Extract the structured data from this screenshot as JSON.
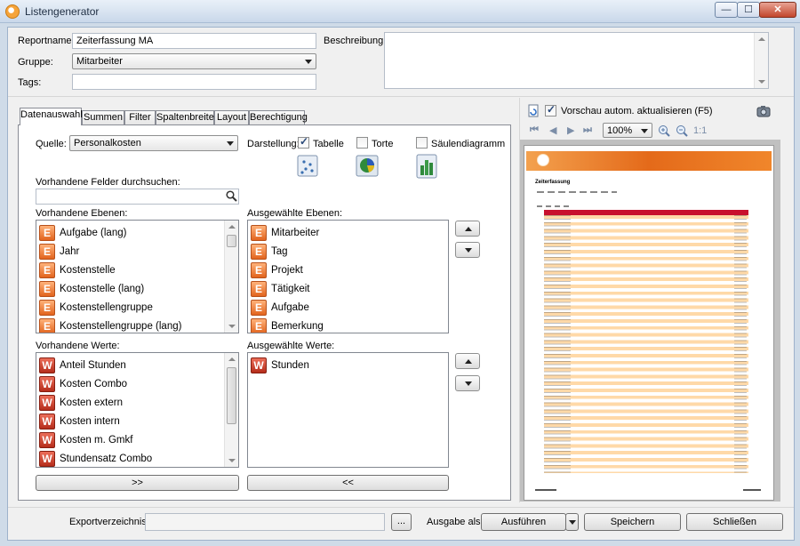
{
  "window": {
    "title": "Listengenerator",
    "min": "—",
    "max": "☐",
    "close": "✕"
  },
  "header": {
    "reportname_label": "Reportname:",
    "reportname_value": "Zeiterfassung MA",
    "gruppe_label": "Gruppe:",
    "gruppe_value": "Mitarbeiter",
    "tags_label": "Tags:",
    "tags_value": "",
    "beschreibung_label": "Beschreibung:",
    "beschreibung_value": ""
  },
  "tabs": [
    "Datenauswahl",
    "Summen",
    "Filter",
    "Spaltenbreite",
    "Layout",
    "Berechtigung"
  ],
  "datenauswahl": {
    "quelle_label": "Quelle:",
    "quelle_value": "Personalkosten",
    "darstellung_label": "Darstellung:",
    "tabelle_label": "Tabelle",
    "torte_label": "Torte",
    "saeulen_label": "Säulendiagramm",
    "tabelle_checked": true,
    "torte_checked": false,
    "saeulen_checked": false,
    "search_label": "Vorhandene Felder durchsuchen:",
    "search_value": "",
    "vorh_ebenen_label": "Vorhandene Ebenen:",
    "vorh_ebenen": [
      "Aufgabe (lang)",
      "Jahr",
      "Kostenstelle",
      "Kostenstelle (lang)",
      "Kostenstellengruppe",
      "Kostenstellengruppe (lang)"
    ],
    "ausg_ebenen_label": "Ausgewählte Ebenen:",
    "ausg_ebenen": [
      "Mitarbeiter",
      "Tag",
      "Projekt",
      "Tätigkeit",
      "Aufgabe",
      "Bemerkung"
    ],
    "vorh_werte_label": "Vorhandene Werte:",
    "vorh_werte": [
      "Anteil Stunden",
      "Kosten Combo",
      "Kosten extern",
      "Kosten intern",
      "Kosten m. Gmkf",
      "Stundensatz Combo"
    ],
    "ausg_werte_label": "Ausgewählte Werte:",
    "ausg_werte": [
      "Stunden"
    ],
    "badge_e": "E",
    "badge_w": "W",
    "add_button": ">>",
    "remove_button": "<<"
  },
  "preview": {
    "auto_update_label": "Vorschau autom. aktualisieren (F5)",
    "auto_update_checked": true,
    "zoom_value": "100%",
    "zoom_reset": "1:1",
    "report_title": "Zeiterfassung"
  },
  "footer": {
    "export_label": "Exportverzeichnis:",
    "export_value": "",
    "browse_button": "...",
    "ausgabe_label": "Ausgabe als:",
    "ausfuehren_button": "Ausführen",
    "speichern_button": "Speichern",
    "schliessen_button": "Schließen"
  },
  "colors": {
    "accent_orange": "#e2641d",
    "title_blue": "#1e2d42",
    "preview_header": "#c8102e",
    "preview_row": "#ffd9a8"
  }
}
